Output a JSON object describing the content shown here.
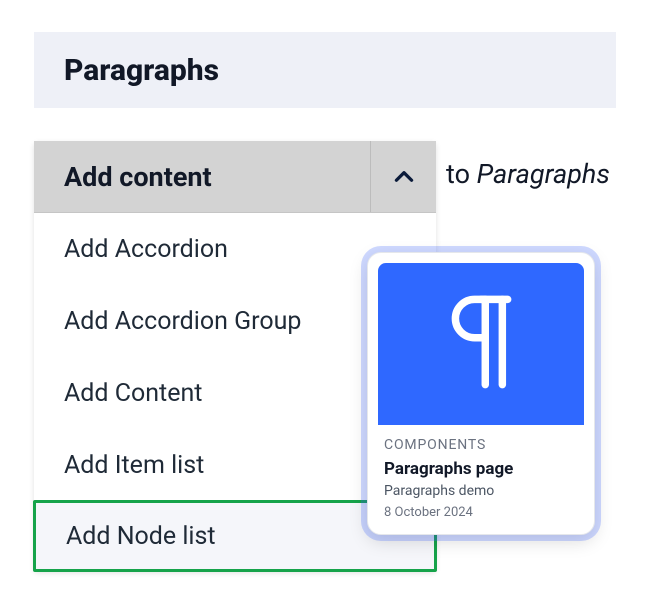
{
  "banner": {
    "title": "Paragraphs"
  },
  "dropdown": {
    "label": "Add content",
    "items": [
      {
        "label": "Add Accordion"
      },
      {
        "label": "Add Accordion Group"
      },
      {
        "label": "Add Content"
      },
      {
        "label": "Add Item list"
      },
      {
        "label": "Add Node list"
      }
    ]
  },
  "inline": {
    "to": "to ",
    "target": "Paragraphs"
  },
  "card": {
    "eyebrow": "COMPONENTS",
    "title": "Paragraphs page",
    "subtitle": "Paragraphs demo",
    "date": "8 October 2024"
  }
}
